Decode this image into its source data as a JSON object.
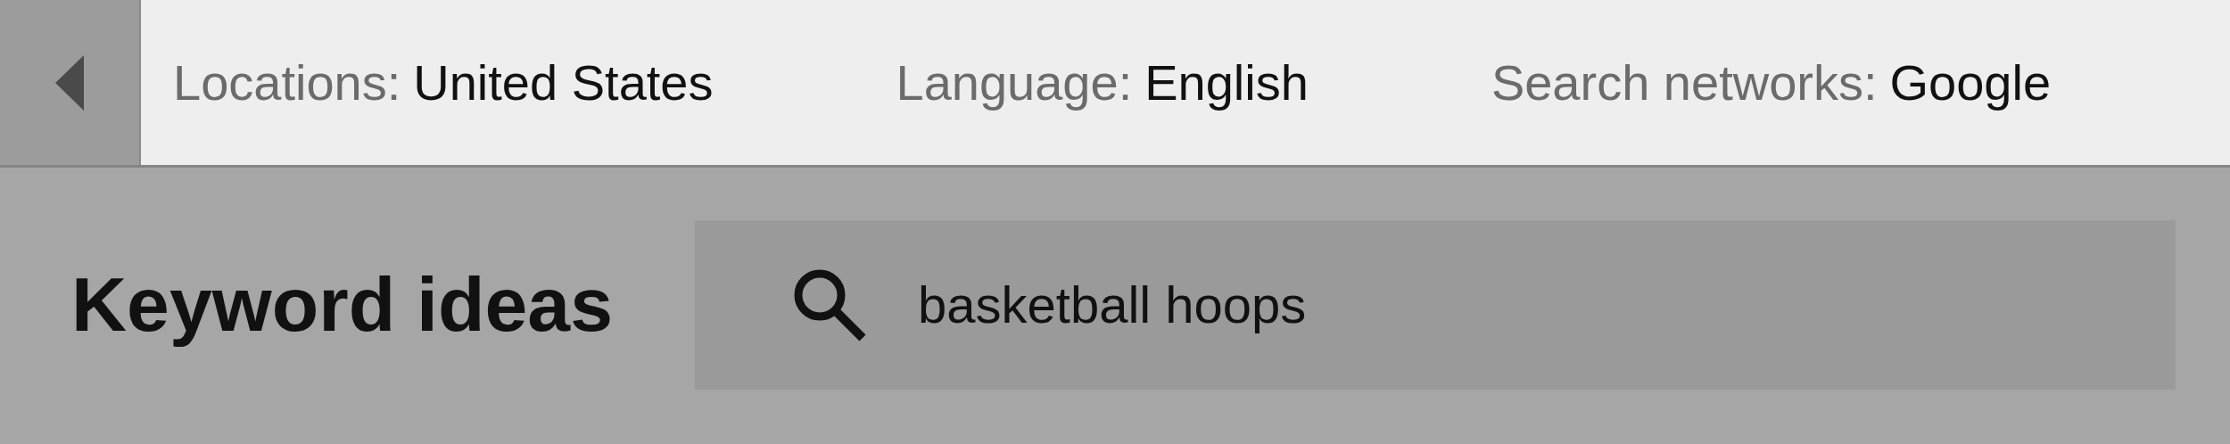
{
  "filters": [
    {
      "label": "Locations:",
      "value": "United States"
    },
    {
      "label": "Language:",
      "value": "English"
    },
    {
      "label": "Search networks:",
      "value": "Google"
    }
  ],
  "heading": "Keyword ideas",
  "search": {
    "value": "basketball hoops"
  }
}
